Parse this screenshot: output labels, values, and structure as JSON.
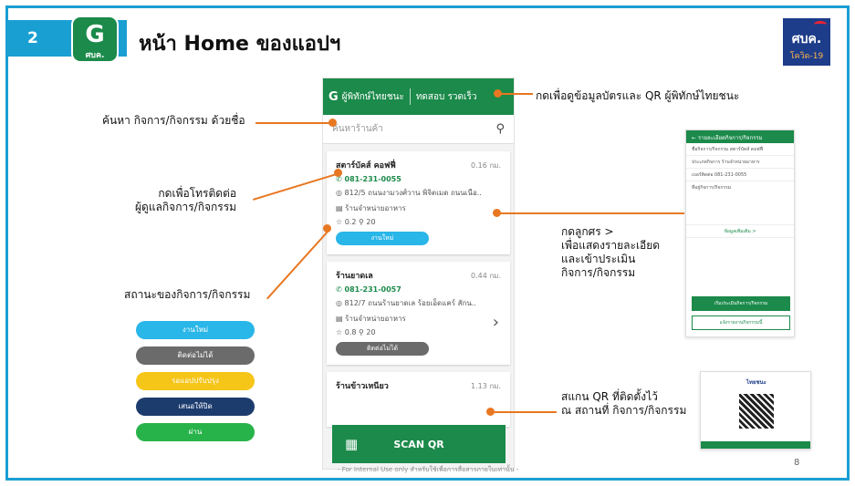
{
  "header": {
    "slide_number": "2",
    "app_icon_glyph": "G",
    "app_icon_text": "ศบค.",
    "title": "หน้า Home ของแอปฯ",
    "logo_text": "ศบค.",
    "logo_sub": "โควิด-19"
  },
  "phone": {
    "app_name": "ผู้พิทักษ์ไทยชนะ",
    "test_link": "ทดสอบ รวดเร็ว",
    "search_placeholder": "ค้นหาร้านค้า",
    "cards": [
      {
        "name": "สตาร์บัคส์ คอฟฟี่",
        "distance": "0.16 กม.",
        "phone": "081-231-0055",
        "address": "812/5 ถนนงามวงศ์วาน พิจิตเมด ถนนเนือ..",
        "category": "ร้านจำหน่ายอาหาร",
        "rating": "☆ 0.2 ⚲ 20",
        "status": "งานใหม่"
      },
      {
        "name": "ร้านยาดเล",
        "distance": "0.44 กม.",
        "phone": "081-231-0057",
        "address": "812/7 ถนนร้านยาดเล ร้อยเอ็ดแคร์ สักน..",
        "category": "ร้านจำหน่ายอาหาร",
        "rating": "☆ 0.8 ⚲ 20",
        "status": "ติดต่อไม่ได้"
      },
      {
        "name": "ร้านข้าวเหนียว",
        "distance": "1.13 กม."
      }
    ],
    "scan_label": "SCAN QR"
  },
  "notes": {
    "search": "ค้นหา กิจการ/กิจกรรม ด้วยชื่อ",
    "call": "กดเพื่อโทรติดต่อ\nผู้ดูแลกิจการ/กิจกรรม",
    "status": "สถานะของกิจการ/กิจกรรม",
    "card_qr": "กดเพื่อดูข้อมูลบัตรและ QR ผู้พิทักษ์ไทยชนะ",
    "detail": "กดลูกศร  >\nเพื่อแสดงรายละเอียด\nและเข้าประเมิน\nกิจการ/กิจกรรม",
    "scan": "สแกน QR ที่ติดตั้งไว้\nณ สถานที่ กิจการ/กิจกรรม"
  },
  "legend": [
    {
      "label": "งานใหม่",
      "color": "#29b6e8"
    },
    {
      "label": "ติดต่อไม่ได้",
      "color": "#6b6b6b"
    },
    {
      "label": "รอแอปปรับปรุง",
      "color": "#f5c518"
    },
    {
      "label": "เสนอให้ปิด",
      "color": "#1d3c6e"
    },
    {
      "label": "ผ่าน",
      "color": "#27b34a"
    }
  ],
  "detail_screen": {
    "title": "รายละเอียดกิจการ/กิจกรรม",
    "rows": [
      "ชื่อกิจการ/กิจกรรม   สตาร์บัคส์ คอฟฟี่",
      "ประเภทกิจการ   ร้านจำหน่ายอาหาร",
      "เบอร์ติดต่อ   081-231-0055",
      "ที่อยู่กิจการ/กิจกรรม"
    ],
    "more": "ข้อมูลเพิ่มเติม  >",
    "primary_button": "เริ่มประเมินกิจการ/กิจกรรม",
    "secondary_button": "แจ้งรายงานกิจกรรมนี้"
  },
  "poster": {
    "brand": "ไทยชนะ"
  },
  "footer": "- For Internal Use only สำหรับใช้เพื่อการสื่อสารภายในเท่านั้น -",
  "page_number": "8"
}
